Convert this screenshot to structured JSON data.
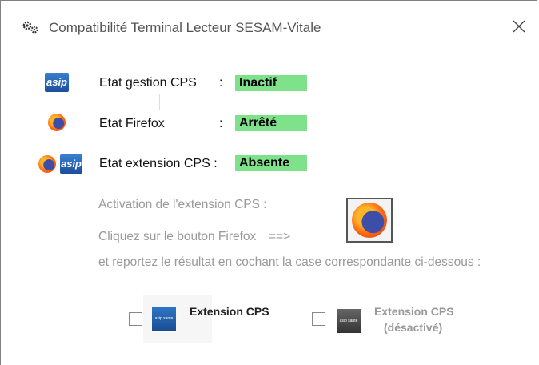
{
  "window": {
    "title": "Compatibilité Terminal Lecteur SESAM-Vitale"
  },
  "status": [
    {
      "label": "Etat gestion CPS",
      "colon": ":",
      "value": "Inactif",
      "icons": [
        "asip-logo"
      ]
    },
    {
      "label": "Etat Firefox",
      "colon": ":",
      "value": "Arrêté",
      "icons": [
        "firefox-icon"
      ]
    },
    {
      "label": "Etat extension CPS :",
      "colon": "",
      "value": "Absente",
      "icons": [
        "firefox-icon",
        "asip-logo"
      ]
    }
  ],
  "asip_text": "asip",
  "instructions": {
    "activation": "Activation de l'extension CPS :",
    "click_firefox": "Cliquez sur le bouton Firefox",
    "arrow": "==>",
    "report": "et reportez le résultat en cochant la case correspondante ci-dessous :"
  },
  "options": [
    {
      "label_line1": "Extension CPS",
      "label_line2": "",
      "checked": false,
      "state": "active"
    },
    {
      "label_line1": "Extension CPS",
      "label_line2": "(désactivé)",
      "checked": false,
      "state": "inactive"
    }
  ],
  "colors": {
    "status_ok_bg": "#7ee28a",
    "muted_text": "#9a9a9a"
  }
}
